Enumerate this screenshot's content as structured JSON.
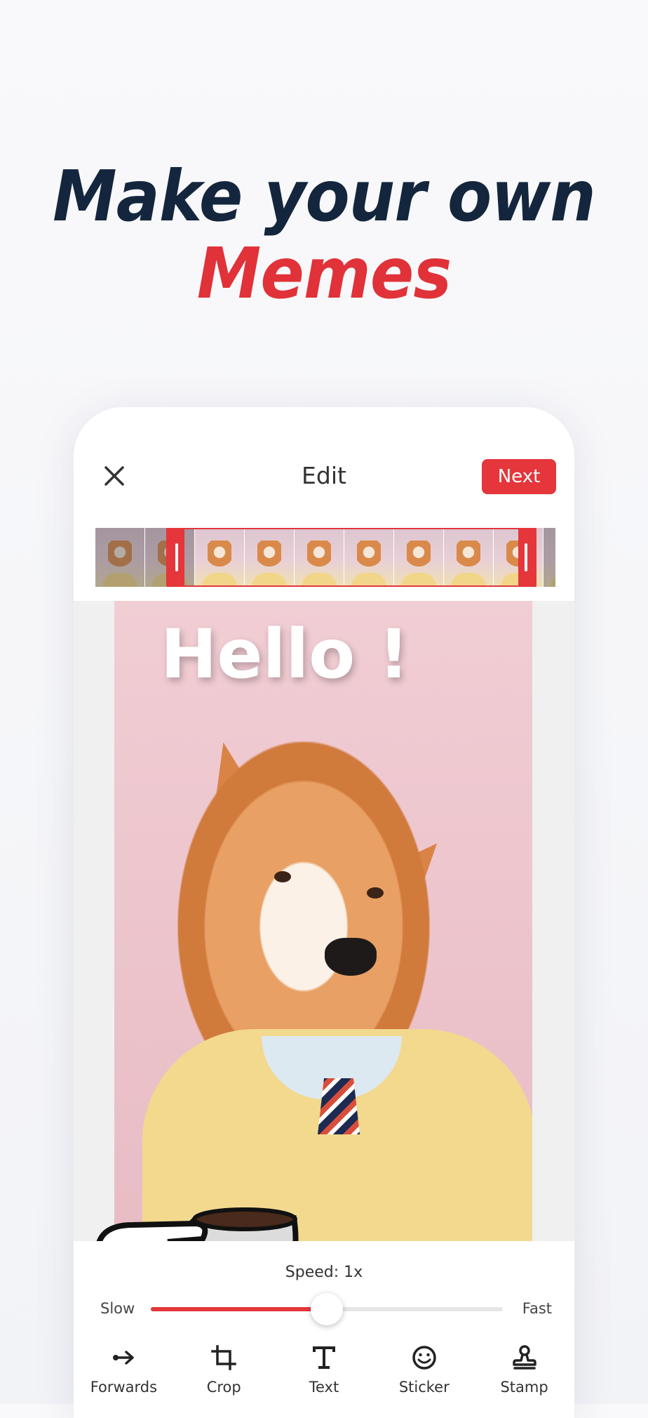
{
  "headline": {
    "line1": "Make your own",
    "line2": "Memes"
  },
  "editor": {
    "title": "Edit",
    "next_label": "Next"
  },
  "timeline": {
    "frame_count": 10
  },
  "canvas": {
    "text_overlay": "Hello !"
  },
  "speed": {
    "label": "Speed: 1x",
    "slow_label": "Slow",
    "fast_label": "Fast",
    "value_fraction": 0.5
  },
  "toolbar": {
    "items": [
      {
        "label": "Forwards",
        "icon": "arrow-forward-icon"
      },
      {
        "label": "Crop",
        "icon": "crop-icon"
      },
      {
        "label": "Text",
        "icon": "text-icon"
      },
      {
        "label": "Sticker",
        "icon": "sticker-icon"
      },
      {
        "label": "Stamp",
        "icon": "stamp-icon"
      }
    ]
  },
  "colors": {
    "accent": "#e4363b",
    "navy": "#14263d"
  }
}
